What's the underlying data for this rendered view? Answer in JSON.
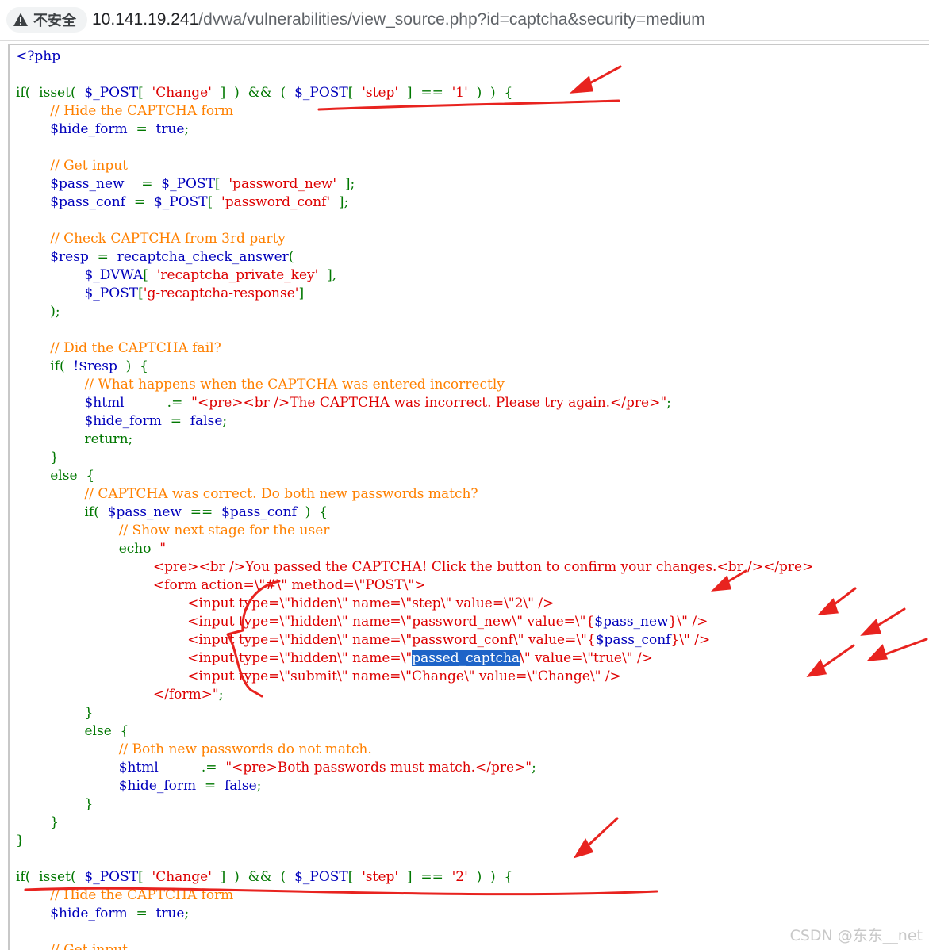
{
  "browser": {
    "security_label": "不安全",
    "url_host": "10.141.19.241",
    "url_path": "/dvwa/vulnerabilities/view_source.php?id=captcha&security=medium"
  },
  "source": {
    "php_open": "<?php",
    "line_if1_a": "if(  isset(  ",
    "line_if1_b": "$_POST",
    "line_if1_c": "[  ",
    "line_if1_d": "'Change'",
    "line_if1_e": "  ]  )  &&  (  ",
    "line_if1_f": "$_POST",
    "line_if1_g": "[  ",
    "line_if1_h": "'step'",
    "line_if1_i": "  ]  ==  ",
    "line_if1_j": "'1'",
    "line_if1_k": "  )  )  {",
    "c_hide1": "// Hide the CAPTCHA form",
    "hide_form_var": "$hide_form",
    "assign_eq": "  =  ",
    "true_kw": "true",
    "semi": ";",
    "c_get_input": "// Get input",
    "pass_new_var": "$pass_new",
    "pass_new_eq": "    =  ",
    "post_var": "$_POST",
    "lb": "[  ",
    "rb": "  ];",
    "password_new_key": "'password_new'",
    "pass_conf_var": "$pass_conf",
    "pass_conf_eq": "  =  ",
    "password_conf_key": "'password_conf'",
    "c_check": "// Check CAPTCHA from 3rd party",
    "resp_var": "$resp",
    "resp_eq": "  =  ",
    "resp_fn": "recaptcha_check_answer",
    "open_paren": "(",
    "dvwa_var": "$_DVWA",
    "private_key": "'recaptcha_private_key'",
    "rb_comma": "  ],",
    "lb_tight": "[",
    "grecap_key": "'g-recaptcha-response'",
    "rb_tight": "]",
    "close_paren_semi": ");",
    "c_fail": "// Did the CAPTCHA fail?",
    "if_open": "if(  ",
    "not_resp": "!$resp",
    "if_close": "  )  {",
    "c_incorrect": "// What happens when the CAPTCHA was entered incorrectly",
    "html_var": "$html",
    "concat_eq": "          .=  ",
    "incorrect_str": "\"<pre><br />The CAPTCHA was incorrect. Please try again.</pre>\"",
    "false_kw": "false",
    "return_kw": "return;",
    "close_brace": "}",
    "else_open": "else  {",
    "c_correct": "// CAPTCHA was correct. Do both new passwords match?",
    "cmp_eq": "  ==  ",
    "if_close2": "  )  {",
    "c_show": "// Show next stage for the user",
    "echo_kw": "echo  ",
    "str_open": "\"",
    "echo_l1": "<pre><br />You passed the CAPTCHA! Click the button to confirm your changes.<br /></pre>",
    "echo_l2": "<form action=\\\"#\\\" method=\\\"POST\\\">",
    "echo_l3": "<input type=\\\"hidden\\\" name=\\\"step\\\" value=\\\"2\\\" />",
    "echo_l4a": "<input type=\\\"hidden\\\" name=\\\"password_new\\\" value=\\\"{",
    "echo_l4b": "}\\\" />",
    "echo_l5a": "<input type=\\\"hidden\\\" name=\\\"password_conf\\\" value=\\\"{",
    "echo_l5b": "}\\\" />",
    "echo_l6a": "<input type=\\\"hidden\\\" name=\\\"",
    "echo_l6_sel": "passed_captcha",
    "echo_l6b": "\\\" value=\\\"true\\\" />",
    "echo_l7": "<input type=\\\"submit\\\" name=\\\"Change\\\" value=\\\"Change\\\" />",
    "echo_l8": "</form>\"",
    "c_nomatch": "// Both new passwords do not match.",
    "must_match_str": "\"<pre>Both passwords must match.</pre>\"",
    "close_brace_main": "}",
    "line_if2_j": "'2'",
    "c_hide2": "// Hide the CAPTCHA form",
    "c_get_input2": "// Get input"
  },
  "watermark": "CSDN @东东__net"
}
